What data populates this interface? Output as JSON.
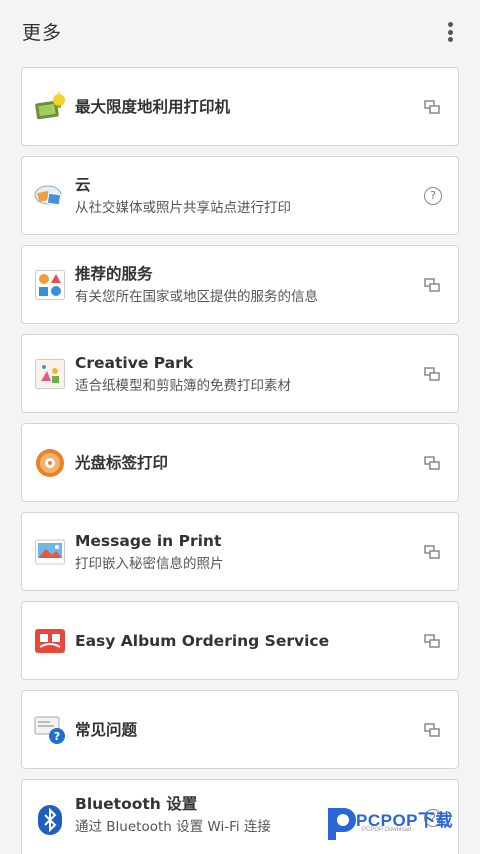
{
  "header": {
    "title": "更多"
  },
  "items": [
    {
      "title": "最大限度地利用打印机",
      "subtitle": "",
      "icon": "printer-lightbulb-icon",
      "action": "external-link-icon"
    },
    {
      "title": "云",
      "subtitle": "从社交媒体或照片共享站点进行打印",
      "icon": "cloud-photo-icon",
      "action": "help-icon"
    },
    {
      "title": "推荐的服务",
      "subtitle": "有关您所在国家或地区提供的服务的信息",
      "icon": "shapes-icon",
      "action": "external-link-icon"
    },
    {
      "title": "Creative Park",
      "subtitle": "适合纸模型和剪贴簿的免费打印素材",
      "icon": "paper-craft-icon",
      "action": "external-link-icon"
    },
    {
      "title": "光盘标签打印",
      "subtitle": "",
      "icon": "disc-icon",
      "action": "external-link-icon"
    },
    {
      "title": "Message in Print",
      "subtitle": "打印嵌入秘密信息的照片",
      "icon": "photo-message-icon",
      "action": "external-link-icon"
    },
    {
      "title": "Easy Album Ordering Service",
      "subtitle": "",
      "icon": "album-icon",
      "action": "external-link-icon"
    },
    {
      "title": "常见问题",
      "subtitle": "",
      "icon": "faq-icon",
      "action": "external-link-icon"
    },
    {
      "title": "Bluetooth 设置",
      "subtitle": "通过 Bluetooth 设置 Wi-Fi 连接",
      "icon": "bluetooth-icon",
      "action": "help-icon"
    }
  ],
  "help_glyph": "?",
  "watermark": {
    "brand": "PCPOP下载",
    "sub": "PCPOP Download"
  }
}
